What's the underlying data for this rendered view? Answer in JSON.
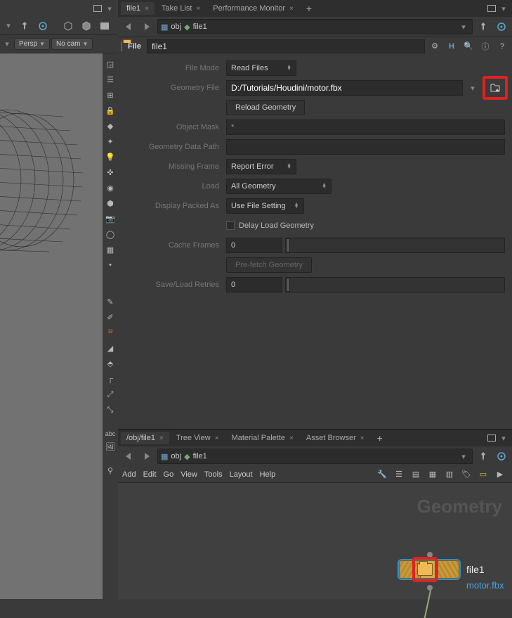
{
  "tabs_top": {
    "items": [
      {
        "label": "file1",
        "active": true
      },
      {
        "label": "Take List",
        "active": false
      },
      {
        "label": "Performance Monitor",
        "active": false
      }
    ]
  },
  "path_top": {
    "seg1": "obj",
    "seg2": "file1"
  },
  "node_bar": {
    "type": "File",
    "name": "file1"
  },
  "params": {
    "file_mode": {
      "label": "File Mode",
      "value": "Read Files"
    },
    "geometry_file": {
      "label": "Geometry File",
      "value": "D:/Tutorials/Houdini/motor.fbx"
    },
    "reload": {
      "label": "Reload Geometry"
    },
    "object_mask": {
      "label": "Object Mask",
      "value": "*"
    },
    "geom_data_path": {
      "label": "Geometry Data Path",
      "value": ""
    },
    "missing_frame": {
      "label": "Missing Frame",
      "value": "Report Error"
    },
    "load": {
      "label": "Load",
      "value": "All Geometry"
    },
    "display_as": {
      "label": "Display Packed As",
      "value": "Use File Setting"
    },
    "delay": {
      "label": "Delay Load Geometry"
    },
    "cache_frames": {
      "label": "Cache Frames",
      "value": "0"
    },
    "prefetch": {
      "label": "Pre-fetch Geometry"
    },
    "retries": {
      "label": "Save/Load Retries",
      "value": "0"
    }
  },
  "left_bar": {
    "persp": "Persp",
    "nocam": "No cam",
    "abc": "abc"
  },
  "tabs_bottom": {
    "items": [
      {
        "label": "/obj/file1",
        "active": true
      },
      {
        "label": "Tree View",
        "active": false
      },
      {
        "label": "Material Palette",
        "active": false
      },
      {
        "label": "Asset Browser",
        "active": false
      }
    ]
  },
  "path_bottom": {
    "seg1": "obj",
    "seg2": "file1"
  },
  "menus": {
    "add": "Add",
    "edit": "Edit",
    "go": "Go",
    "view": "View",
    "tools": "Tools",
    "layout": "Layout",
    "help": "Help"
  },
  "network": {
    "title": "Geometry",
    "node_name": "file1",
    "file_name": "motor.fbx"
  }
}
